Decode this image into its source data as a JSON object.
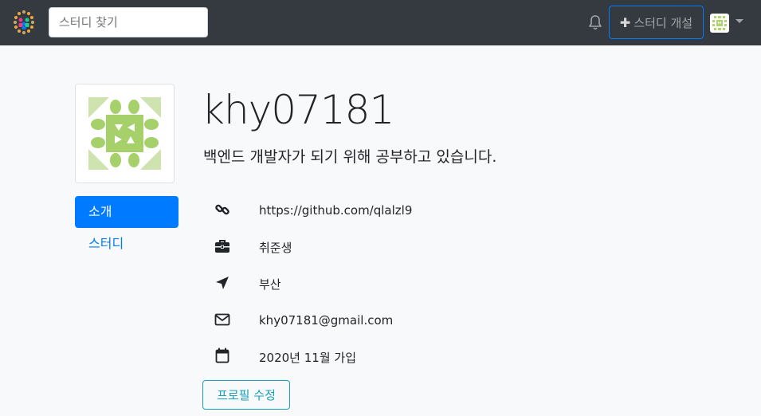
{
  "header": {
    "search_placeholder": "스터디 찾기",
    "new_study_label": "스터디 개설",
    "accent_color": "#007bff",
    "nav_bg": "#343a40"
  },
  "profile": {
    "username": "khy07181",
    "bio": "백엔드 개발자가 되기 위해 공부하고 있습니다.",
    "url": "https://github.com/qlalzl9",
    "occupation": "취준생",
    "location": "부산",
    "email": "khy07181@gmail.com",
    "joined": "2020년 11월 가입",
    "edit_label": "프로필 수정"
  },
  "sidebar": {
    "items": [
      {
        "label": "소개",
        "active": true
      },
      {
        "label": "스터디",
        "active": false
      }
    ]
  },
  "icons": {
    "brand": "logo-icon",
    "bell": "bell-icon",
    "url": "link-icon",
    "occupation": "briefcase-icon",
    "location": "location-arrow-icon",
    "email": "envelope-icon",
    "joined": "calendar-icon"
  }
}
